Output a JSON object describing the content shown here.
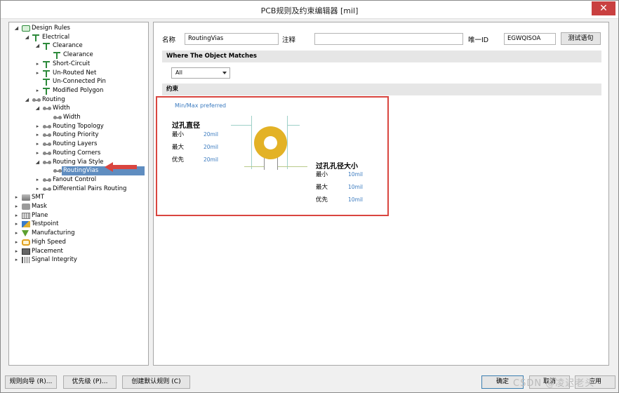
{
  "window": {
    "title": "PCB规则及约束编辑器 [mil]",
    "close_glyph": "✕"
  },
  "tree": [
    {
      "label": "Design Rules",
      "level": 0,
      "expand": "◢",
      "icon": "rules-folder-icon"
    },
    {
      "label": "Electrical",
      "level": 1,
      "expand": "◢",
      "icon": "electrical-icon"
    },
    {
      "label": "Clearance",
      "level": 2,
      "expand": "◢",
      "icon": "clearance-icon"
    },
    {
      "label": "Clearance",
      "level": 3,
      "expand": "",
      "icon": "rule-icon"
    },
    {
      "label": "Short-Circuit",
      "level": 2,
      "expand": "▸",
      "icon": "rule-icon"
    },
    {
      "label": "Un-Routed Net",
      "level": 2,
      "expand": "▸",
      "icon": "rule-icon"
    },
    {
      "label": "Un-Connected Pin",
      "level": 2,
      "expand": "",
      "icon": "rule-icon"
    },
    {
      "label": "Modified Polygon",
      "level": 2,
      "expand": "▸",
      "icon": "rule-icon"
    },
    {
      "label": "Routing",
      "level": 1,
      "expand": "◢",
      "icon": "routing-icon"
    },
    {
      "label": "Width",
      "level": 2,
      "expand": "◢",
      "icon": "routing-icon"
    },
    {
      "label": "Width",
      "level": 3,
      "expand": "",
      "icon": "routing-icon"
    },
    {
      "label": "Routing Topology",
      "level": 2,
      "expand": "▸",
      "icon": "routing-icon"
    },
    {
      "label": "Routing Priority",
      "level": 2,
      "expand": "▸",
      "icon": "routing-icon"
    },
    {
      "label": "Routing Layers",
      "level": 2,
      "expand": "▸",
      "icon": "routing-icon"
    },
    {
      "label": "Routing Corners",
      "level": 2,
      "expand": "▸",
      "icon": "routing-icon"
    },
    {
      "label": "Routing Via Style",
      "level": 2,
      "expand": "◢",
      "icon": "routing-icon"
    },
    {
      "label": "RoutingVias",
      "level": 3,
      "expand": "",
      "icon": "routing-icon",
      "selected": true
    },
    {
      "label": "Fanout Control",
      "level": 2,
      "expand": "▸",
      "icon": "routing-icon"
    },
    {
      "label": "Differential Pairs Routing",
      "level": 2,
      "expand": "▸",
      "icon": "routing-icon"
    },
    {
      "label": "SMT",
      "level": 0,
      "expand": "▸",
      "icon": "smt-icon"
    },
    {
      "label": "Mask",
      "level": 0,
      "expand": "▸",
      "icon": "mask-icon"
    },
    {
      "label": "Plane",
      "level": 0,
      "expand": "▸",
      "icon": "plane-icon"
    },
    {
      "label": "Testpoint",
      "level": 0,
      "expand": "▸",
      "icon": "testpoint-icon"
    },
    {
      "label": "Manufacturing",
      "level": 0,
      "expand": "▸",
      "icon": "manufacturing-icon"
    },
    {
      "label": "High Speed",
      "level": 0,
      "expand": "▸",
      "icon": "high-speed-icon"
    },
    {
      "label": "Placement",
      "level": 0,
      "expand": "▸",
      "icon": "placement-icon"
    },
    {
      "label": "Signal Integrity",
      "level": 0,
      "expand": "▸",
      "icon": "signal-integrity-icon"
    }
  ],
  "rule": {
    "name_label": "名称",
    "name_value": "RoutingVias",
    "comment_label": "注释",
    "comment_value": "",
    "id_label": "唯一ID",
    "id_value": "EGWQISOA",
    "test_button": "测试语句"
  },
  "match": {
    "section_title": "Where The Object Matches",
    "scope_value": "All"
  },
  "constraints": {
    "section_title": "约束",
    "mode_label": "Min/Max preferred",
    "via_diameter": {
      "title": "过孔直径",
      "min_label": "最小",
      "min_value": "20mil",
      "max_label": "最大",
      "max_value": "20mil",
      "pref_label": "优先",
      "pref_value": "20mil"
    },
    "hole_size": {
      "title": "过孔孔径大小",
      "min_label": "最小",
      "min_value": "10mil",
      "max_label": "最大",
      "max_value": "10mil",
      "pref_label": "优先",
      "pref_value": "10mil"
    },
    "via_color": "#e3b226",
    "highlight_color": "#d9453f"
  },
  "footer": {
    "wizard_button": "规则向导 (R)...",
    "priority_button": "优先级 (P)...",
    "default_rules_button": "创建默认规则 (C)",
    "ok_button": "确定",
    "cancel_button": "取消",
    "apply_button": "应用",
    "watermark": "CSDN @凌迟老头"
  }
}
